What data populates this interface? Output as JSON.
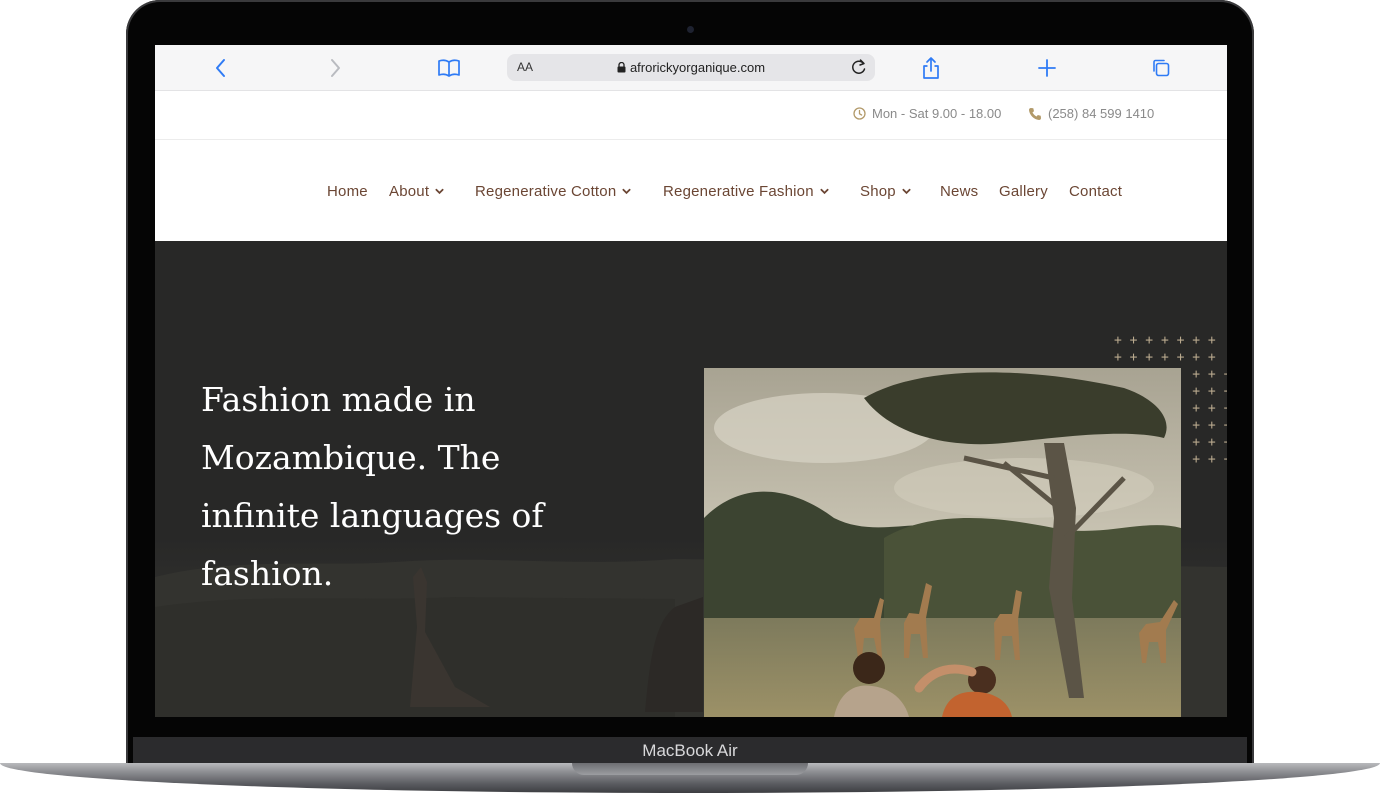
{
  "browser": {
    "text_size_label": "AA",
    "url": "afrorickyorganique.com"
  },
  "topbar": {
    "hours": "Mon - Sat 9.00 - 18.00",
    "phone": "(258) 84 599 1410"
  },
  "nav": {
    "items": [
      {
        "label": "Home",
        "dropdown": false
      },
      {
        "label": "About",
        "dropdown": true
      },
      {
        "label": "Regenerative Cotton",
        "dropdown": true
      },
      {
        "label": "Regenerative Fashion",
        "dropdown": true
      },
      {
        "label": "Shop",
        "dropdown": true
      },
      {
        "label": "News",
        "dropdown": false
      },
      {
        "label": "Gallery",
        "dropdown": false
      },
      {
        "label": "Contact",
        "dropdown": false
      }
    ]
  },
  "hero": {
    "title": "Fashion made in Mozambique. The infinite languages of fashion."
  },
  "device": {
    "label": "MacBook Air"
  },
  "colors": {
    "nav_text": "#6b4634",
    "hero_bg": "#282827",
    "accent_plus": "#b9a98e",
    "browser_blue": "#2f7bf5"
  }
}
